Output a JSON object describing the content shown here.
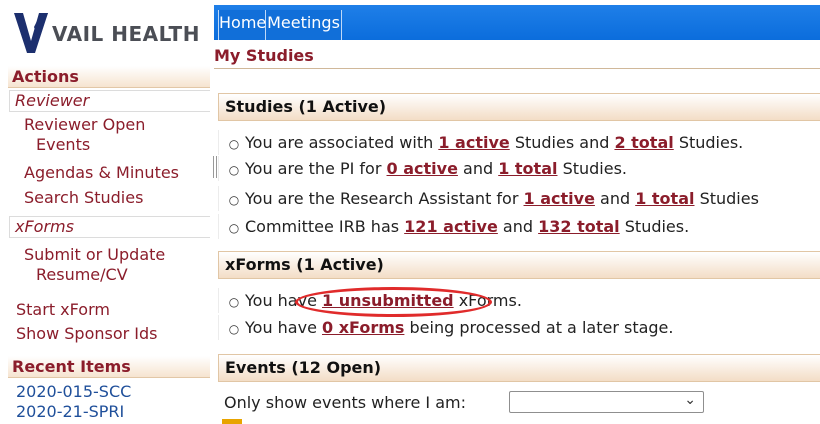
{
  "logo": {
    "text": "VAIL HEALTH"
  },
  "nav": {
    "tabs": [
      "Home",
      "Meetings"
    ]
  },
  "page": {
    "title": "My Studies"
  },
  "sidebar": {
    "actions_header": "Actions",
    "reviewer_group": "Reviewer",
    "reviewer_links": [
      "Reviewer Open",
      "Events",
      "Agendas & Minutes",
      "Search Studies"
    ],
    "xforms_group": "xForms",
    "xforms_links": [
      "Submit or Update",
      "Resume/CV"
    ],
    "other_links": [
      "Start xForm",
      "Show Sponsor Ids"
    ],
    "recent_header": "Recent Items",
    "recent_items": [
      "2020-015-SCC",
      "2020-21-SPRI"
    ]
  },
  "studies": {
    "header": "Studies (1 Active)",
    "rows": [
      {
        "pre": "You are associated with ",
        "l1": "1 active",
        "mid": " Studies and ",
        "l2": "2 total",
        "post": " Studies."
      },
      {
        "pre": "You are the PI for ",
        "l1": "0 active",
        "mid": " and ",
        "l2": "1 total",
        "post": " Studies."
      },
      {
        "pre": "You are the Research Assistant for ",
        "l1": "1 active",
        "mid": " and ",
        "l2": "1 total",
        "post": " Studies"
      },
      {
        "pre": "Committee IRB has ",
        "l1": "121 active",
        "mid": " and ",
        "l2": "132 total",
        "post": " Studies."
      }
    ]
  },
  "xforms": {
    "header": "xForms (1 Active)",
    "rows": [
      {
        "pre": "You have ",
        "l1": "1 unsubmitted",
        "post": " xForms."
      },
      {
        "pre": "You have ",
        "l1": "0 xForms",
        "post": " being processed at a later stage."
      }
    ]
  },
  "events": {
    "header": "Events (12 Open)",
    "filter_label": "Only show events where I am:",
    "filter_value": ""
  },
  "colors": {
    "accent": "#8b1d2b",
    "nav": "#0b6ddc",
    "annotation": "#e02b2b"
  }
}
